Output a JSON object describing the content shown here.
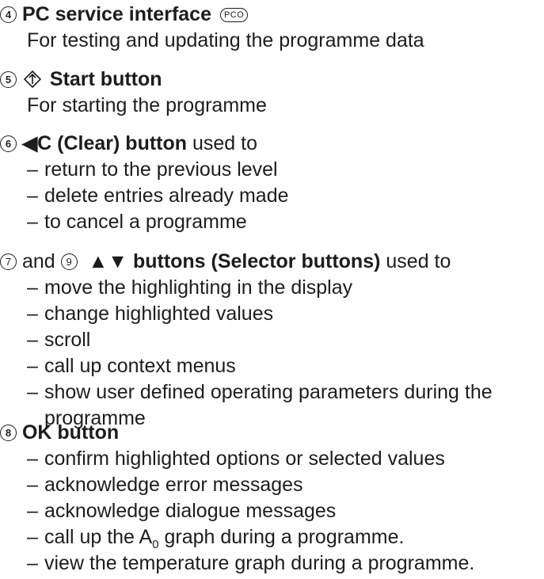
{
  "s4": {
    "num": "4",
    "title": "PC service interface",
    "badge": "PCO",
    "desc": "For testing and updating the programme data"
  },
  "s5": {
    "num": "5",
    "title": "Start button",
    "desc": "For starting the programme"
  },
  "s6": {
    "num": "6",
    "title": "◀C (Clear) button",
    "suffix": " used to",
    "items": [
      "return to the previous level",
      "delete entries already made",
      "to cancel a programme"
    ]
  },
  "s7": {
    "num_a": "7",
    "and": " and ",
    "num_b": "9",
    "title": "▲▼ buttons (Selector buttons)",
    "suffix": " used to",
    "items": [
      "move the highlighting in the display",
      "change highlighted values",
      "scroll",
      "call up context menus",
      "show user defined operating parameters during the",
      "programme"
    ]
  },
  "s8": {
    "num": "8",
    "title": "OK button",
    "items": [
      "confirm highlighted options or selected values",
      "acknowledge error messages",
      "acknowledge dialogue messages"
    ],
    "item_a0_pre": "call up the A",
    "item_a0_sub": "0",
    "item_a0_post": " graph during a programme.",
    "item_last": "view the temperature graph during a programme."
  },
  "dash": "–"
}
